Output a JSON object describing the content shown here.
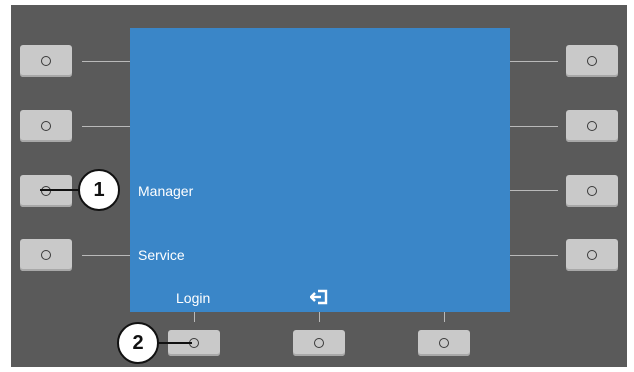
{
  "screen": {
    "left_labels": [
      "",
      "",
      "Manager",
      "Service"
    ],
    "bottom_labels": [
      "Login",
      ""
    ],
    "bottom_icon": "exit-arrow-icon",
    "background_color": "#3a86c8"
  },
  "softkeys": {
    "left_count": 4,
    "right_count": 4,
    "bottom_count": 3,
    "key_symbol": "O"
  },
  "callouts": {
    "manager_key": "1",
    "login_key": "2"
  },
  "colors": {
    "panel": "#5a5a5a",
    "key": "#c9c9c9",
    "callout_border": "#111111"
  }
}
